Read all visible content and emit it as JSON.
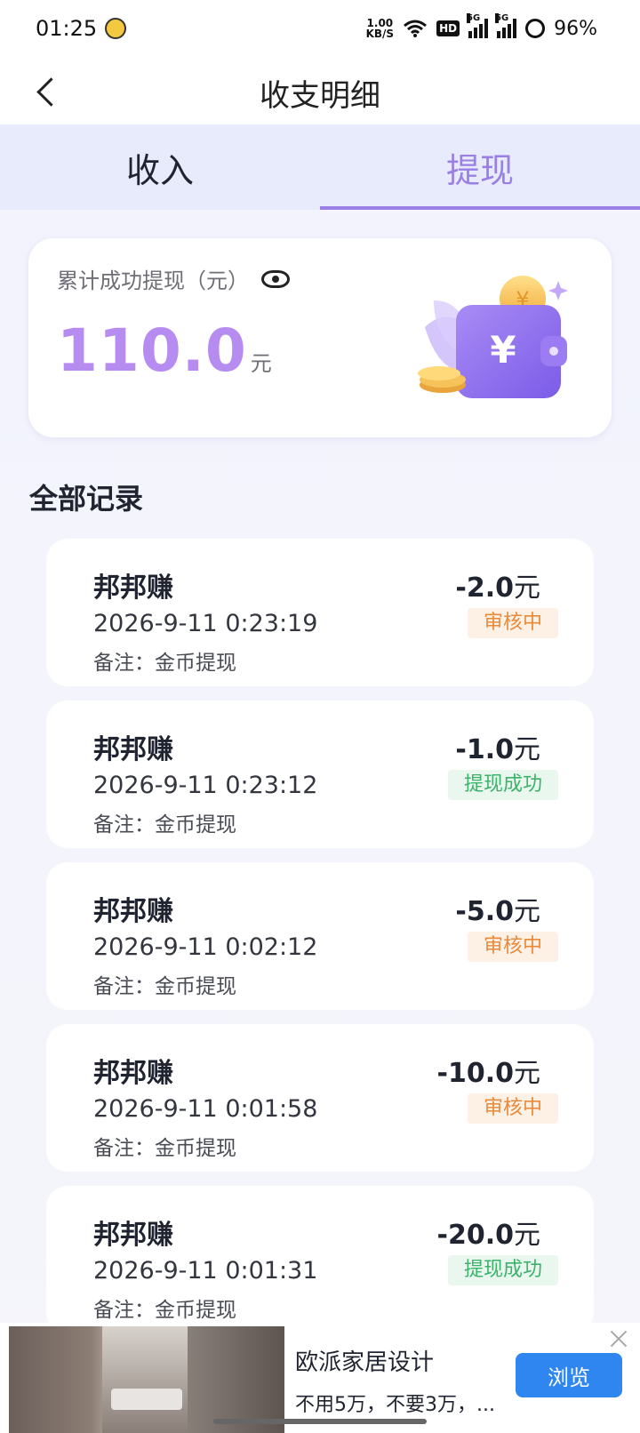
{
  "status_bar": {
    "time": "01:25",
    "net_speed_value": "1.00",
    "net_speed_unit": "KB/S",
    "hd_label": "HD",
    "signal1_label": "5G",
    "signal2_label": "5G",
    "battery": "96%"
  },
  "header": {
    "title": "收支明细"
  },
  "tabs": [
    {
      "label": "收入",
      "active": false
    },
    {
      "label": "提现",
      "active": true
    }
  ],
  "summary": {
    "label": "累计成功提现（元）",
    "amount": "110.0",
    "unit": "元"
  },
  "records_section": {
    "title": "全部记录"
  },
  "records": [
    {
      "name": "邦邦赚",
      "time": "2026-9-11 0:23:19",
      "note": "备注：金币提现",
      "amount": "-2.0",
      "unit": "元",
      "status": "审核中"
    },
    {
      "name": "邦邦赚",
      "time": "2026-9-11 0:23:12",
      "note": "备注：金币提现",
      "amount": "-1.0",
      "unit": "元",
      "status": "提现成功"
    },
    {
      "name": "邦邦赚",
      "time": "2026-9-11 0:02:12",
      "note": "备注：金币提现",
      "amount": "-5.0",
      "unit": "元",
      "status": "审核中"
    },
    {
      "name": "邦邦赚",
      "time": "2026-9-11 0:01:58",
      "note": "备注：金币提现",
      "amount": "-10.0",
      "unit": "元",
      "status": "审核中"
    },
    {
      "name": "邦邦赚",
      "time": "2026-9-11 0:01:31",
      "note": "备注：金币提现",
      "amount": "-20.0",
      "unit": "元",
      "status": "提现成功"
    }
  ],
  "ad": {
    "title": "欧派家居设计",
    "description": "不用5万，不要3万，...",
    "button_label": "浏览"
  },
  "colors": {
    "accent": "#9a7fe6",
    "amount_purple": "#b78cf0",
    "status_pending": "#e88a3a",
    "status_success": "#3bb36a",
    "ad_button": "#2f86f0"
  }
}
